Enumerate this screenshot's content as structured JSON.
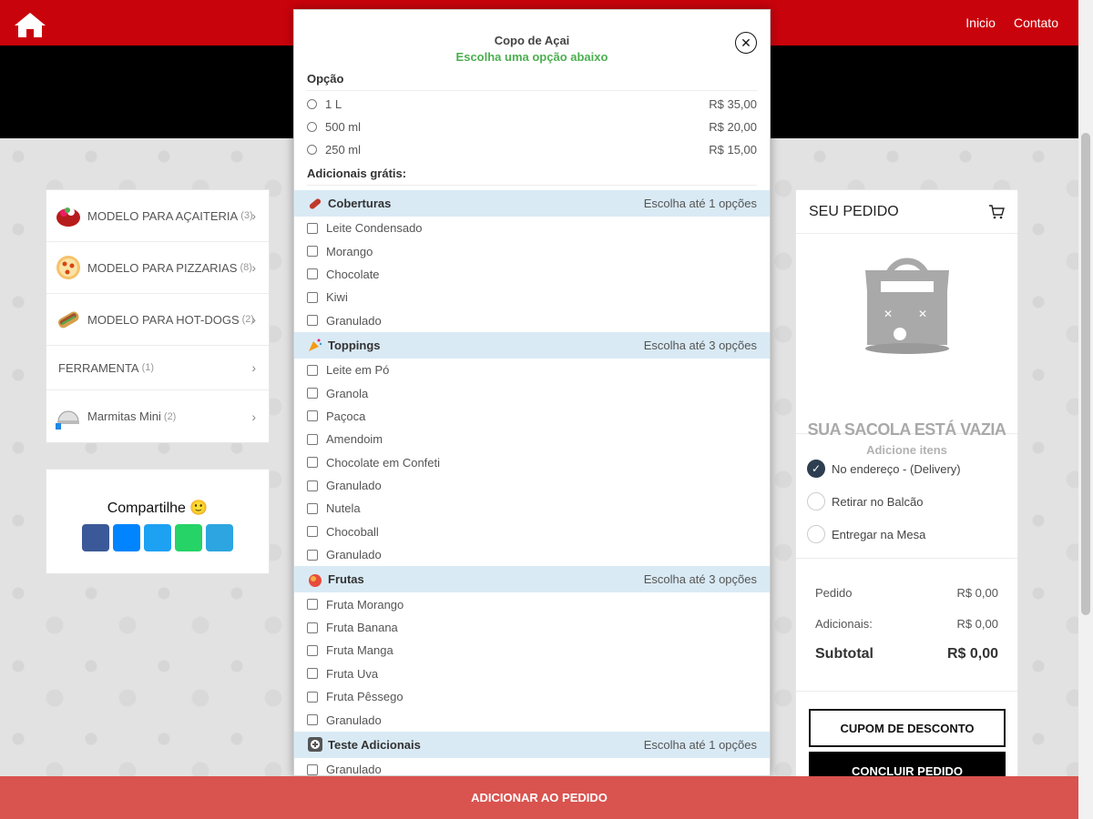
{
  "nav": {
    "links": [
      "Inicio",
      "Contato"
    ]
  },
  "categories": [
    {
      "label": "MODELO PARA AÇAITERIA",
      "count": "(3)"
    },
    {
      "label": "MODELO PARA PIZZARIAS",
      "count": "(8)"
    },
    {
      "label": "MODELO PARA HOT-DOGS",
      "count": "(2)"
    },
    {
      "label": "FERRAMENTA",
      "count": "(1)"
    },
    {
      "label": "Marmitas Mini",
      "count": "(2)"
    }
  ],
  "share": {
    "title": "Compartilhe 🙂"
  },
  "order": {
    "title": "SEU PEDIDO",
    "empty_title": "SUA SACOLA ESTÁ VAZIA",
    "empty_sub": "Adicione itens",
    "delivery_options": [
      "No endereço - (Delivery)",
      "Retirar no Balcão",
      "Entregar na Mesa"
    ],
    "pedido_label": "Pedido",
    "pedido_value": "R$ 0,00",
    "adicionais_label": "Adicionais:",
    "adicionais_value": "R$ 0,00",
    "subtotal_label": "Subtotal",
    "subtotal_value": "R$ 0,00",
    "coupon_label": "CUPOM DE DESCONTO",
    "finish_label": "CONCLUIR PEDIDO"
  },
  "modal": {
    "title": "Copo de Açai",
    "subtitle": "Escolha uma opção abaixo",
    "option_label": "Opção",
    "options": [
      {
        "label": "1 L",
        "price": "R$ 35,00"
      },
      {
        "label": "500 ml",
        "price": "R$ 20,00"
      },
      {
        "label": "250 ml",
        "price": "R$ 15,00"
      }
    ],
    "addons_label": "Adicionais grátis:",
    "groups": [
      {
        "name": "Coberturas",
        "limit": "Escolha até 1 opções",
        "icon": "sauce-icon",
        "items": [
          "Leite Condensado",
          "Morango",
          "Chocolate",
          "Kiwi",
          "Granulado"
        ]
      },
      {
        "name": "Toppings",
        "limit": "Escolha até 3 opções",
        "icon": "party-icon",
        "items": [
          "Leite em Pó",
          "Granola",
          "Paçoca",
          "Amendoim",
          "Chocolate em Confeti",
          "Granulado",
          "Nutela",
          "Chocoball",
          "Granulado"
        ]
      },
      {
        "name": "Frutas",
        "limit": "Escolha até 3 opções",
        "icon": "fruit-icon",
        "items": [
          "Fruta Morango",
          "Fruta Banana",
          "Fruta Manga",
          "Fruta Uva",
          "Fruta Pêssego",
          "Granulado"
        ]
      },
      {
        "name": "Teste Adicionais",
        "limit": "Escolha até 1 opções",
        "icon": "plus-box-icon",
        "items": [
          "Granulado"
        ]
      }
    ]
  },
  "add_button": "ADICIONAR AO PEDIDO",
  "colors": {
    "brand_red": "#c9030c",
    "add_bar": "#d9534f",
    "group_bg": "#d9eaf5",
    "subtitle_green": "#4caf50"
  }
}
